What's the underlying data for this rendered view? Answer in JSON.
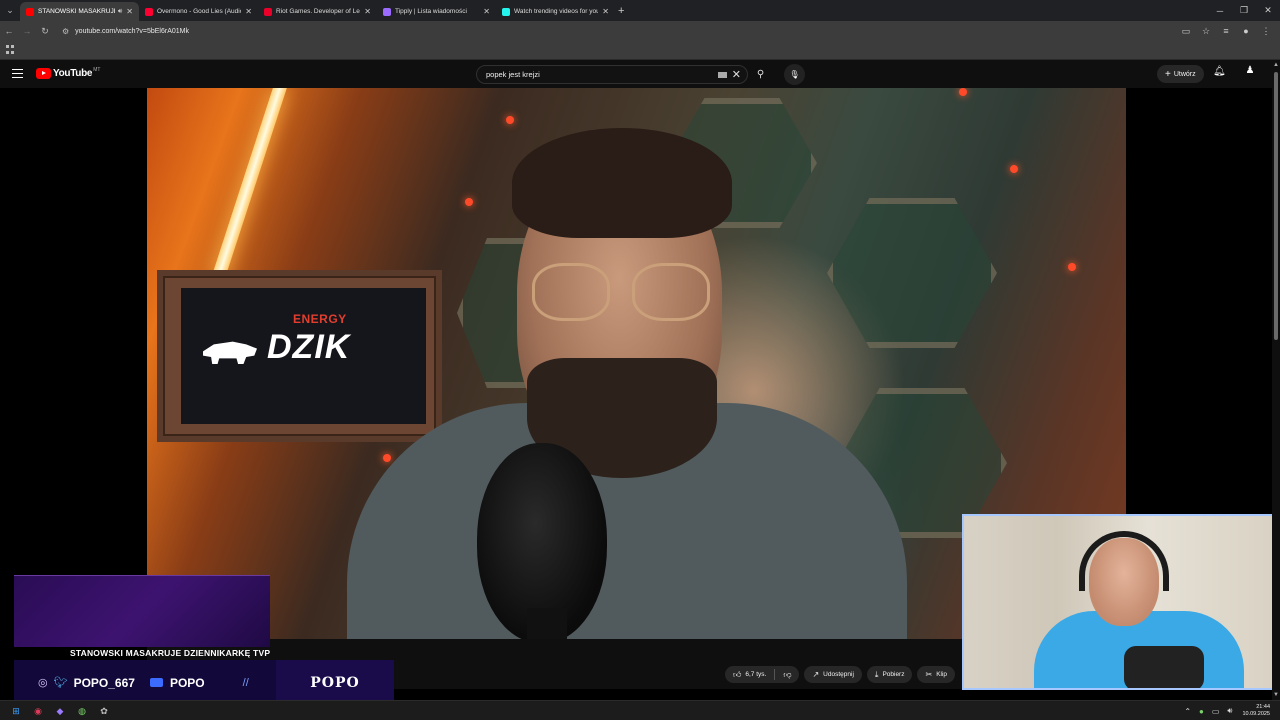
{
  "browser": {
    "tabs": [
      {
        "title": "STANOWSKI MASAKRUJE D",
        "favicon_color": "#ff0000",
        "active": true,
        "audio": true
      },
      {
        "title": "Overmono - Good Lies (Audio)",
        "favicon_color": "#ff0033",
        "active": false
      },
      {
        "title": "Riot Games. Developer of League",
        "favicon_color": "#eb0029",
        "active": false
      },
      {
        "title": "Tipply | Lista wiadomości",
        "favicon_color": "#9b6bff",
        "active": false
      },
      {
        "title": "Watch trending videos for you",
        "favicon_color": "#25f4ee",
        "active": false
      }
    ],
    "url": "youtube.com/watch?v=5bEl6rA01Mk"
  },
  "youtube": {
    "logo_text": "YouTube",
    "country_code": "MT",
    "search_query": "popek jest krejzi",
    "create_label": "Utwórz"
  },
  "video": {
    "sign_energy": "ENERGY",
    "sign_brand": "DZIK"
  },
  "actions": {
    "likes": "6,7 tys.",
    "share": "Udostępnij",
    "download": "Pobierz",
    "clip": "Klip"
  },
  "stream_overlay": {
    "title": "STANOWSKI MASAKRUJE DZIENNIKARKĘ TVP",
    "handle": "POPO_667",
    "channel": "POPO",
    "brand": "POPO"
  },
  "taskbar": {
    "time": "21:44",
    "date": "10.09.2025"
  },
  "colors": {
    "youtube_red": "#ff0000",
    "overlay_purple": "#3d1370",
    "webcam_border": "#a7c7ff"
  }
}
